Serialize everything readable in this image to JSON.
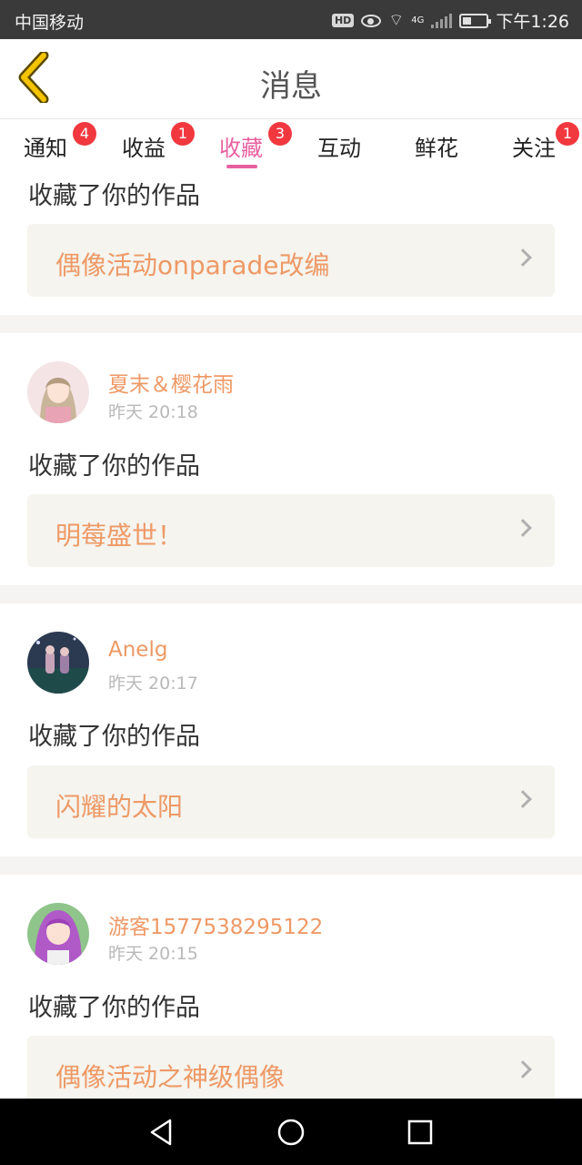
{
  "status_bar": {
    "carrier": "中国移动",
    "time": "下午1:26",
    "hd": "HD",
    "net": "4G"
  },
  "header": {
    "title": "消息",
    "icons": {
      "back": "chevron-left-icon"
    }
  },
  "tabs": [
    {
      "label": "通知",
      "badge": "4"
    },
    {
      "label": "收益",
      "badge": "1"
    },
    {
      "label": "收藏",
      "badge": "3",
      "active": true
    },
    {
      "label": "互动",
      "badge": ""
    },
    {
      "label": "鲜花",
      "badge": ""
    },
    {
      "label": "关注",
      "badge": "1"
    }
  ],
  "top_item": {
    "action": "收藏了你的作品",
    "work": "偶像活动onparade改编"
  },
  "items": [
    {
      "user": "夏末＆樱花雨",
      "time": "昨天 20:18",
      "action": "收藏了你的作品",
      "work": "明莓盛世！"
    },
    {
      "user": "Anelg",
      "time": "昨天 20:17",
      "action": "收藏了你的作品",
      "work": "闪耀的太阳"
    },
    {
      "user": "游客1577538295122",
      "time": "昨天 20:15",
      "action": "收藏了你的作品",
      "work": "偶像活动之神级偶像"
    }
  ],
  "colors": {
    "accent": "#e8609f",
    "orange": "#ee9966",
    "badge": "#f2383f",
    "back_icon": "#f5c400"
  },
  "nav": {
    "icons": [
      "back-triangle-icon",
      "home-circle-icon",
      "recents-square-icon"
    ]
  }
}
